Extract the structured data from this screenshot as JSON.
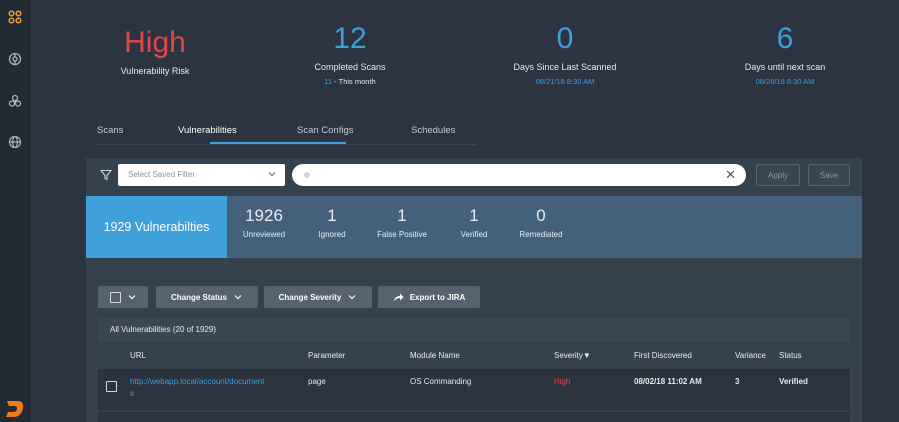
{
  "sidebar": {
    "icons": [
      "apps-icon",
      "target-icon",
      "biohazard-icon",
      "globe-icon"
    ],
    "logo": "brand-logo"
  },
  "stats": {
    "risk": {
      "value": "High",
      "label": "Vulnerability Risk"
    },
    "completed": {
      "value": "12",
      "label": "Completed Scans",
      "sub_count": "11",
      "sub_text": " - This month"
    },
    "since_last": {
      "value": "0",
      "label": "Days Since Last Scanned",
      "date": "08/21/18 8:30 AM"
    },
    "until_next": {
      "value": "6",
      "label": "Days until next scan",
      "date": "08/28/18 8:30 AM"
    }
  },
  "tabs": [
    {
      "label": "Scans"
    },
    {
      "label": "Vulnerabilities",
      "active": true
    },
    {
      "label": "Scan Configs"
    },
    {
      "label": "Schedules"
    }
  ],
  "filter": {
    "select_placeholder": "Select Saved Filter",
    "search_value": "",
    "apply_label": "Apply",
    "save_label": "Save"
  },
  "summary": {
    "total_label": "1929 Vulnerabilties",
    "counts": [
      {
        "value": "1926",
        "label": "Unreviewed"
      },
      {
        "value": "1",
        "label": "Ignored"
      },
      {
        "value": "1",
        "label": "False Positive"
      },
      {
        "value": "1",
        "label": "Verified"
      },
      {
        "value": "0",
        "label": "Remediated"
      }
    ]
  },
  "actions": {
    "change_status": "Change Status",
    "change_severity": "Change Severity",
    "export": "Export to JIRA"
  },
  "table": {
    "title": "All Vulnerabilities (20 of 1929)",
    "columns": [
      "URL",
      "Parameter",
      "Module Name",
      "Severity▼",
      "First Discovered",
      "Variance",
      "Status"
    ],
    "rows": [
      {
        "url_line1": "http://webapp.local/account/document",
        "url_line2": "s",
        "parameter": "page",
        "module": "OS Commanding",
        "severity": "High",
        "first_discovered": "08/02/18 11:02 AM",
        "variance": "3",
        "status": "Verified"
      }
    ]
  },
  "colors": {
    "accent": "#3f9fd8",
    "risk_high": "#e0474a",
    "background": "#2b3440",
    "panel": "#36414e",
    "summary_bar": "#45617a"
  }
}
